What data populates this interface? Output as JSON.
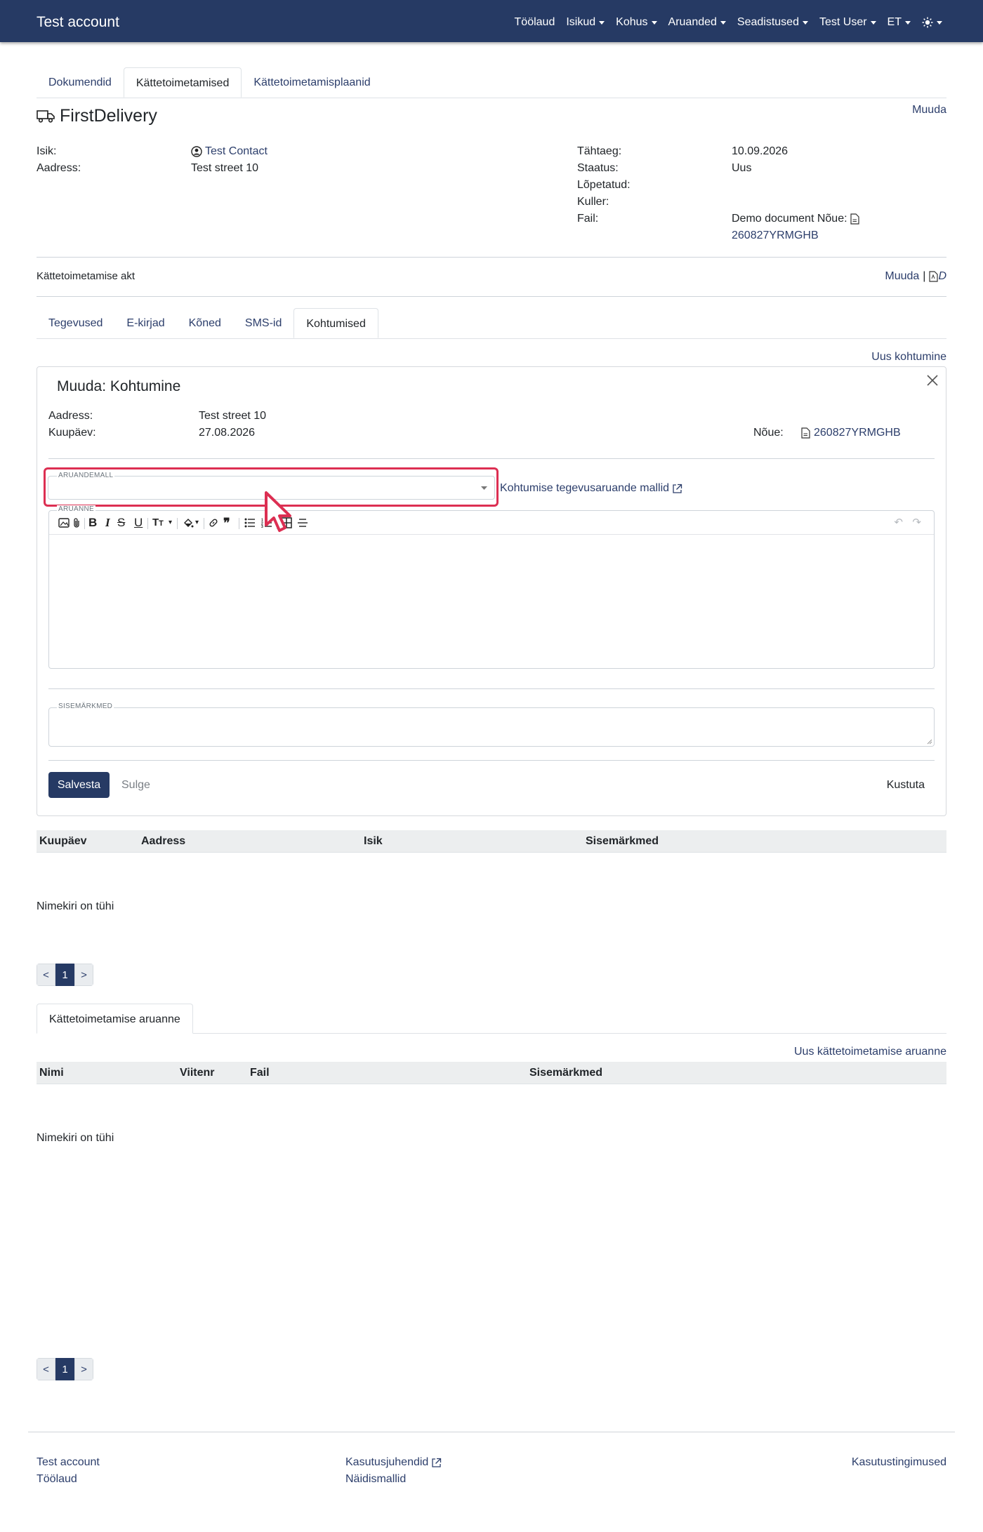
{
  "navbar": {
    "brand": "Test account",
    "items": [
      "Töölaud",
      "Isikud",
      "Kohus",
      "Aruanded",
      "Seadistused",
      "Test User",
      "ET"
    ]
  },
  "top_tabs": [
    "Dokumendid",
    "Kättetoimetamised",
    "Kättetoimetamisplaanid"
  ],
  "delivery": {
    "title": "FirstDelivery",
    "edit_label": "Muuda",
    "left": [
      {
        "label": "Isik:",
        "value": "Test Contact"
      },
      {
        "label": "Aadress:",
        "value": "Test street 10"
      }
    ],
    "right_labels": [
      "Tähtaeg:",
      "Staatus:",
      "Lõpetatud:",
      "Kuller:",
      "Fail:"
    ],
    "deadline": "10.09.2026",
    "status": "Uus",
    "file_name": "Demo document Nõue:",
    "file_ref": "260827YRMGHB"
  },
  "act": {
    "title": "Kättetoimetamise akt",
    "edit_label": "Muuda",
    "separator": "|",
    "pdf_label": "D"
  },
  "sub_tabs": [
    "Tegevused",
    "E-kirjad",
    "Kõned",
    "SMS-id",
    "Kohtumised"
  ],
  "new_meeting_label": "Uus kohtumine",
  "meeting_form": {
    "title": "Muuda: Kohtumine",
    "address_label": "Aadress:",
    "address_value": "Test street 10",
    "date_label": "Kuupäev:",
    "date_value": "27.08.2026",
    "claim_label": "Nõue:",
    "claim_value": "260827YRMGHB",
    "template_label": "ARUANDEMALL",
    "templates_link": "Kohtumise tegevusaruande mallid",
    "report_label": "ARUANNE",
    "notes_label": "SISEMÄRKMED",
    "save_label": "Salvesta",
    "close_label": "Sulge",
    "delete_label": "Kustuta"
  },
  "meetings_table": {
    "headers": [
      "Kuupäev",
      "Aadress",
      "Isik",
      "Sisemärkmed"
    ],
    "empty": "Nimekiri on tühi",
    "pager": {
      "prev": "<",
      "page": "1",
      "next": ">"
    }
  },
  "report_tab": "Kättetoimetamise aruanne",
  "new_report_label": "Uus kättetoimetamise aruanne",
  "reports_table": {
    "headers": [
      "Nimi",
      "Viitenr",
      "Fail",
      "Sisemärkmed"
    ],
    "empty": "Nimekiri on tühi",
    "pager": {
      "prev": "<",
      "page": "1",
      "next": ">"
    }
  },
  "footer": {
    "col1": [
      "Test account",
      "Töölaud"
    ],
    "col2": [
      "Kasutusjuhendid",
      "Näidismallid"
    ],
    "col3": [
      "Kasutustingimused"
    ]
  },
  "colors": {
    "navbar": "#263a64",
    "highlight": "#dc2f52",
    "link": "#2c3e6b"
  }
}
